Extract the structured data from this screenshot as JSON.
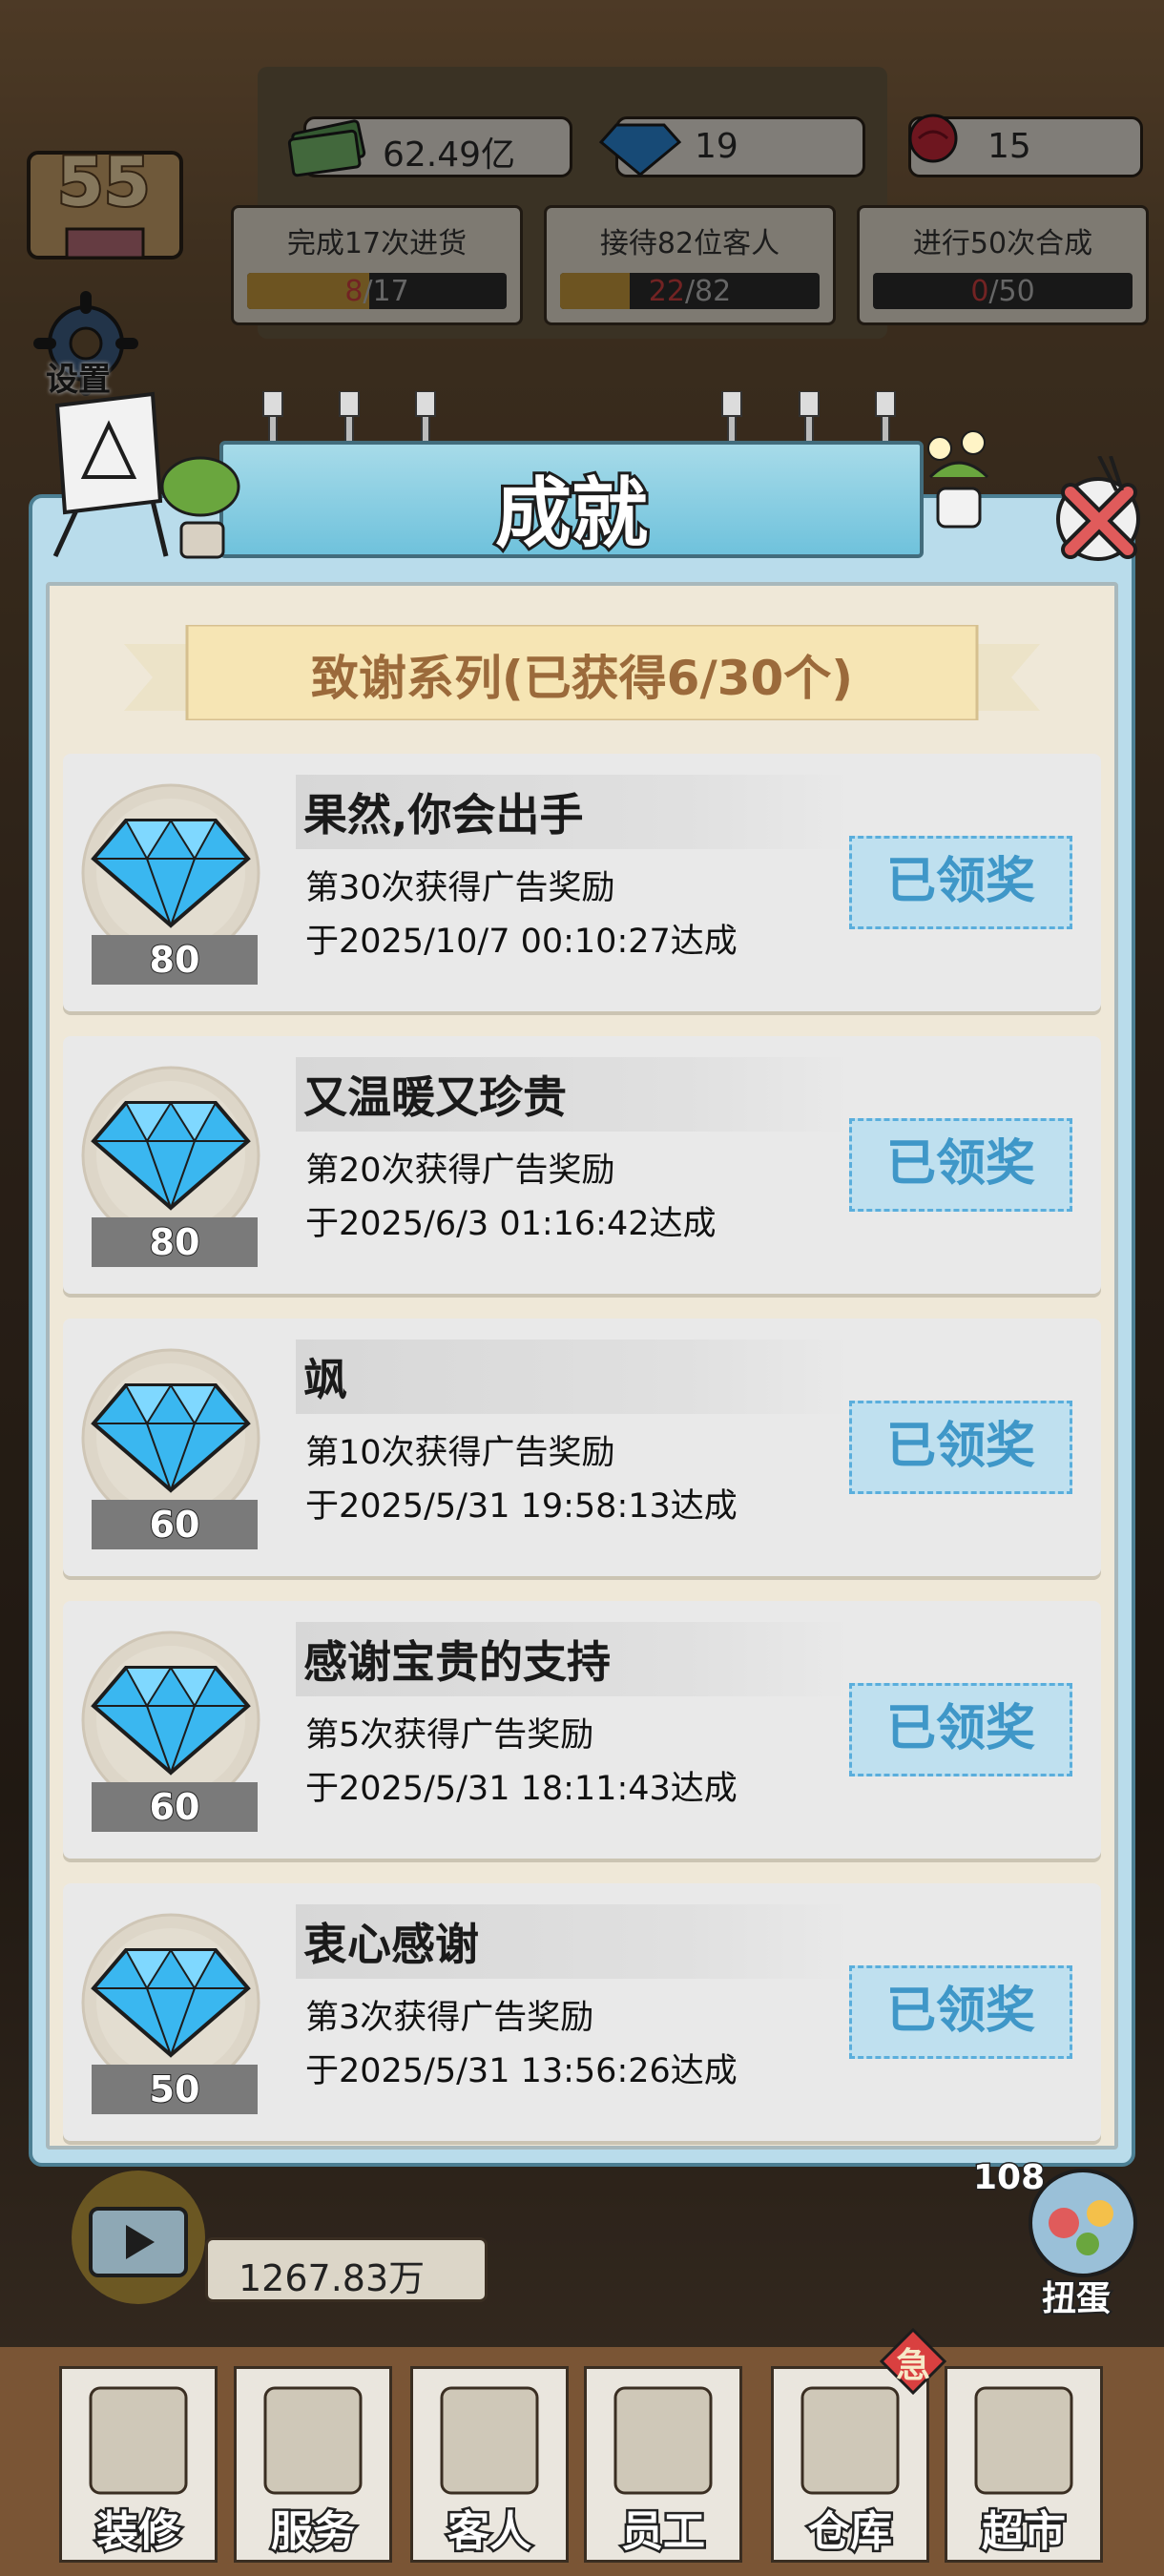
{
  "hud": {
    "level": "55",
    "settings_label": "设置",
    "money": "62.49亿",
    "gems": "19",
    "roses": "15",
    "tasks": [
      {
        "label": "完成17次进货",
        "current": "8",
        "total": "/17",
        "progress": 0.47
      },
      {
        "label": "接待82位客人",
        "current": "22",
        "total": "/82",
        "progress": 0.27
      },
      {
        "label": "进行50次合成",
        "current": "0",
        "total": "/50",
        "progress": 0.0
      }
    ]
  },
  "modal": {
    "title": "成就",
    "series_banner": "致谢系列(已获得6/30个)",
    "achievements": [
      {
        "reward": "80",
        "name": "果然,你会出手",
        "desc": "第30次获得广告奖励",
        "date": "于2025/10/7 00:10:27达成",
        "status": "已领奖"
      },
      {
        "reward": "80",
        "name": "又温暖又珍贵",
        "desc": "第20次获得广告奖励",
        "date": "于2025/6/3 01:16:42达成",
        "status": "已领奖"
      },
      {
        "reward": "60",
        "name": "飒",
        "desc": "第10次获得广告奖励",
        "date": "于2025/5/31 19:58:13达成",
        "status": "已领奖"
      },
      {
        "reward": "60",
        "name": "感谢宝贵的支持",
        "desc": "第5次获得广告奖励",
        "date": "于2025/5/31 18:11:43达成",
        "status": "已领奖"
      },
      {
        "reward": "50",
        "name": "衷心感谢",
        "desc": "第3次获得广告奖励",
        "date": "于2025/5/31 13:56:26达成",
        "status": "已领奖"
      }
    ]
  },
  "bottom": {
    "video_money": "1267.83万",
    "gacha_count": "108",
    "gacha_label": "扭蛋",
    "urgent": "急",
    "nav": [
      {
        "label": "装修"
      },
      {
        "label": "服务"
      },
      {
        "label": "客人"
      },
      {
        "label": "员工"
      },
      {
        "label": "仓库"
      },
      {
        "label": "超市"
      }
    ]
  },
  "colors": {
    "modal_frame": "#b9dceb",
    "modal_panel": "#efe8d8",
    "claim_text": "#3f97c8",
    "banner_text": "#9b6a3b"
  }
}
